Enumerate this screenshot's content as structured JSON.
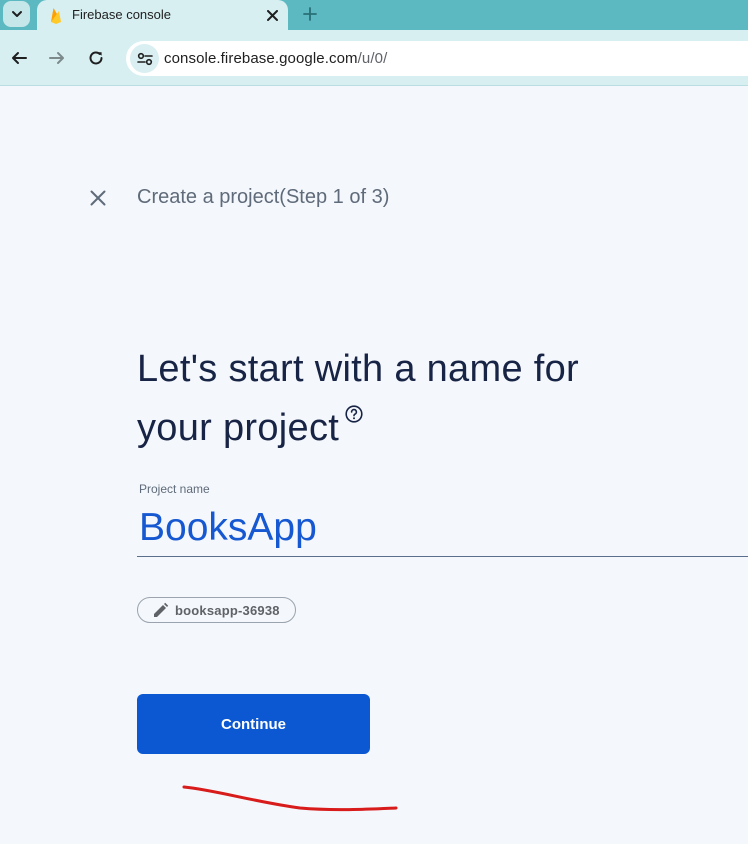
{
  "browser": {
    "tab": {
      "title": "Firebase console",
      "favicon": "firebase-flame-icon"
    },
    "address_bar": {
      "host": "console.firebase.google.com",
      "path": "/u/0/"
    },
    "accent_color": "#5db9c1"
  },
  "page": {
    "step_title": "Create a project(Step 1 of 3)",
    "heading_line1": "Let's start with a name for",
    "heading_line2": "your project",
    "project_name_label": "Project name",
    "project_name_value": "BooksApp",
    "project_id_chip": "booksapp-36938",
    "continue_label": "Continue"
  },
  "colors": {
    "primary_button": "#0b58d2",
    "input_text": "#1658d1",
    "heading": "#182445",
    "annotation_stroke": "#d81b1b"
  },
  "icons": [
    "chevron-down-icon",
    "close-icon",
    "plus-icon",
    "back-arrow-icon",
    "forward-arrow-icon",
    "reload-icon",
    "site-settings-icon",
    "help-circle-icon",
    "pencil-icon"
  ]
}
